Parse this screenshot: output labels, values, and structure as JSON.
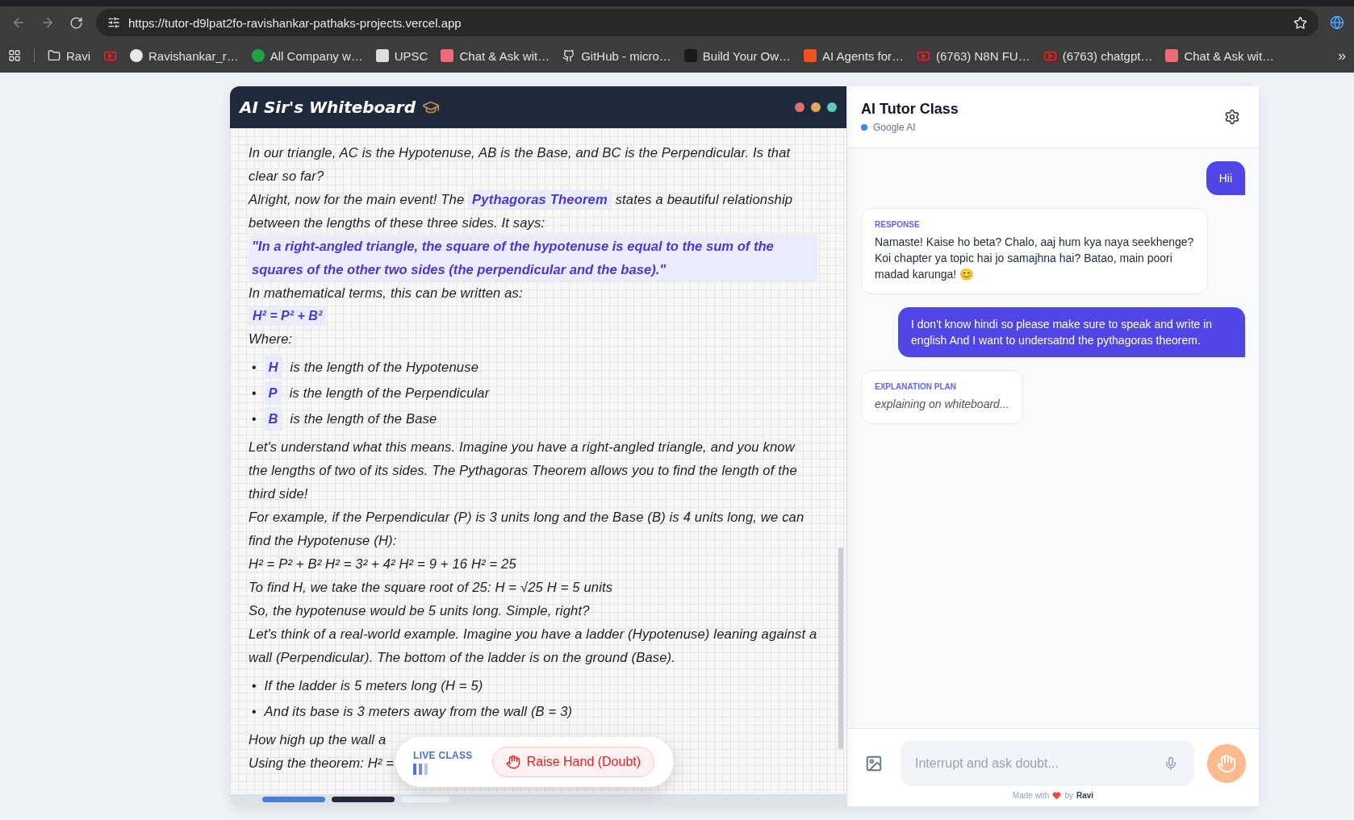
{
  "browser": {
    "url": "https://tutor-d9lpat2fo-ravishankar-pathaks-projects.vercel.app",
    "more": "»",
    "bookmarks": [
      {
        "kind": "folder",
        "label": "Ravi"
      },
      {
        "kind": "youtube"
      },
      {
        "kind": "site",
        "label": "Ravishankar_r…"
      },
      {
        "kind": "site",
        "label": "All Company w…"
      },
      {
        "kind": "site",
        "label": "UPSC"
      },
      {
        "kind": "site",
        "label": "Chat & Ask wit…"
      },
      {
        "kind": "github",
        "label": "GitHub - micro…"
      },
      {
        "kind": "site",
        "label": "Build Your Ow…"
      },
      {
        "kind": "site",
        "label": "AI Agents for…"
      },
      {
        "kind": "youtube",
        "label": "(6763) N8N FU…"
      },
      {
        "kind": "youtube",
        "label": "(6763) chatgpt…"
      },
      {
        "kind": "site",
        "label": "Chat & Ask wit…"
      }
    ]
  },
  "whiteboard": {
    "title": "AI Sir's Whiteboard",
    "blocks": [
      {
        "kind": "text",
        "text": "In our triangle, AC is the Hypotenuse, AB is the Base, and BC is the Perpendicular. Is that clear so far?"
      },
      {
        "kind": "text",
        "text": "Alright, now for the main event! The **Pythagoras Theorem** states a beautiful relationship between the lengths of these three sides. It says:"
      },
      {
        "kind": "quote",
        "text": "\"In a right-angled triangle, the square of the hypotenuse is equal to the sum of the squares of the other two sides (the perpendicular and the base).\""
      },
      {
        "kind": "text",
        "text": "In mathematical terms, this can be written as:"
      },
      {
        "kind": "formula",
        "text": "H² = P² + B²"
      },
      {
        "kind": "text",
        "text": "Where:"
      },
      {
        "kind": "list",
        "bullet": "•",
        "items": [
          {
            "term": "H",
            "text": "is the length of the Hypotenuse"
          },
          {
            "term": "P",
            "text": "is the length of the Perpendicular"
          },
          {
            "term": "B",
            "text": "is the length of the Base"
          }
        ]
      },
      {
        "kind": "text",
        "text": "Let's understand what this means. Imagine you have a right-angled triangle, and you know the lengths of two of its sides. The Pythagoras Theorem allows you to find the length of the third side!"
      },
      {
        "kind": "text",
        "text": "For example, if the Perpendicular (P) is 3 units long and the Base (B) is 4 units long, we can find the Hypotenuse (H):"
      },
      {
        "kind": "text",
        "text": "H² = P² + B² H² = 3² + 4² H² = 9 + 16 H² = 25"
      },
      {
        "kind": "text",
        "text": "To find H, we take the square root of 25: H = √25 H = 5 units"
      },
      {
        "kind": "text",
        "text": "So, the hypotenuse would be 5 units long. Simple, right?"
      },
      {
        "kind": "text",
        "text": "Let's think of a real-world example. Imagine you have a ladder (Hypotenuse) leaning against a wall (Perpendicular). The bottom of the ladder is on the ground (Base)."
      },
      {
        "kind": "list",
        "bullet": "•",
        "items": [
          {
            "text": "If the ladder is 5 meters long (H = 5)"
          },
          {
            "text": "And its base is 3 meters away from the wall (B = 3)"
          }
        ]
      },
      {
        "kind": "text",
        "text": "How high up the wall a"
      },
      {
        "kind": "text",
        "text": "Using the theorem: H² ="
      }
    ],
    "live": {
      "label": "LIVE CLASS",
      "button": "Raise Hand (Doubt)"
    },
    "pages": [
      {
        "kind": "active"
      },
      {
        "kind": "done"
      },
      {
        "kind": "pending"
      }
    ]
  },
  "chat": {
    "title": "AI Tutor Class",
    "provider": {
      "label": "Google AI",
      "color": "#3b82f6"
    },
    "messages": [
      {
        "kind": "user",
        "text": "Hii"
      },
      {
        "kind": "tutor",
        "label": "RESPONSE",
        "text": "Namaste! Kaise ho beta? Chalo, aaj hum kya naya seekhenge? Koi chapter ya topic hai jo samajhna hai? Batao, main poori madad karunga! 😊",
        "italic": false
      },
      {
        "kind": "user",
        "text": "I don't know hindi so please make sure to speak and write in english And I want to undersatnd the pythagoras theorem."
      },
      {
        "kind": "tutor",
        "label": "EXPLANATION PLAN",
        "text": "explaining on whiteboard...",
        "italic": true
      }
    ],
    "input": {
      "placeholder": "Interrupt and ask doubt..."
    },
    "credit": {
      "before": "Made with",
      "by": "by",
      "name": "Ravi"
    }
  }
}
